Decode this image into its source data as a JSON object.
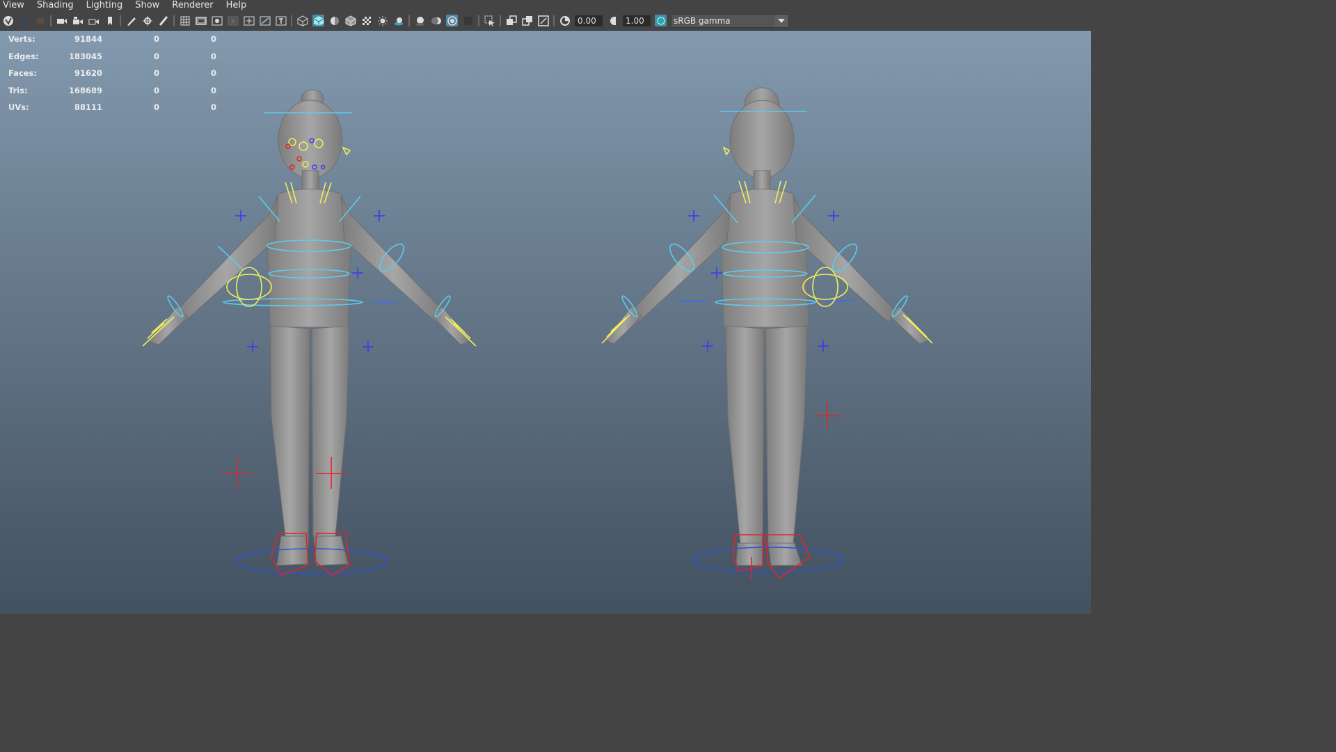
{
  "menu": [
    "View",
    "Shading",
    "Lighting",
    "Show",
    "Renderer",
    "Help"
  ],
  "toolbar": {
    "exposure": "0.00",
    "gamma": "1.00",
    "color_space": "sRGB gamma"
  },
  "hud": {
    "rows": [
      {
        "label": "Verts:",
        "value": "91844",
        "c1": "0",
        "c2": "0"
      },
      {
        "label": "Edges:",
        "value": "183045",
        "c1": "0",
        "c2": "0"
      },
      {
        "label": "Faces:",
        "value": "91620",
        "c1": "0",
        "c2": "0"
      },
      {
        "label": "Tris:",
        "value": "168689",
        "c1": "0",
        "c2": "0"
      },
      {
        "label": "UVs:",
        "value": "88111",
        "c1": "0",
        "c2": "0"
      }
    ]
  },
  "colors": {
    "control_cyan": "#5ccbf0",
    "control_yellow": "#f2ee5c",
    "control_red": "#e0252a",
    "control_blue": "#3a3aef",
    "mesh_gray": "#9a9a9a"
  }
}
